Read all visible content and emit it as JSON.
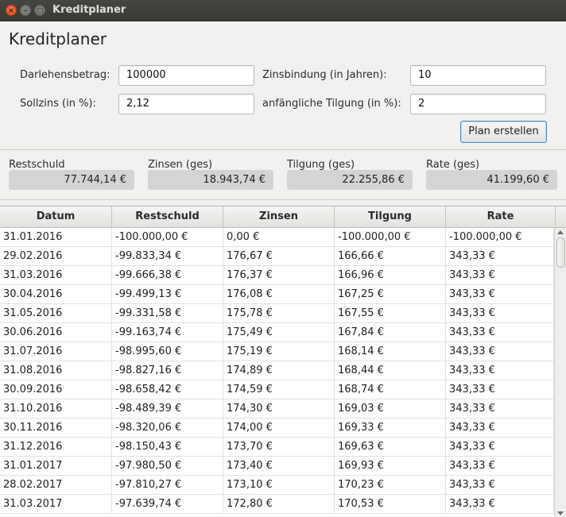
{
  "window": {
    "title": "Kreditplaner",
    "close_glyph": "×",
    "min_glyph": "–",
    "max_glyph": "□"
  },
  "app_title": "Kreditplaner",
  "form": {
    "darlehensbetrag_label": "Darlehensbetrag:",
    "darlehensbetrag_value": "100000",
    "zinsbindung_label": "Zinsbindung (in Jahren):",
    "zinsbindung_value": "10",
    "sollzins_label": "Sollzins (in %):",
    "sollzins_value": "2,12",
    "tilgung_label": "anfängliche Tilgung (in %):",
    "tilgung_value": "2",
    "plan_button": "Plan erstellen"
  },
  "summary": [
    {
      "label": "Restschuld",
      "value": "77.744,14 €"
    },
    {
      "label": "Zinsen (ges)",
      "value": "18.943,74 €"
    },
    {
      "label": "Tilgung (ges)",
      "value": "22.255,86 €"
    },
    {
      "label": "Rate (ges)",
      "value": "41.199,60 €"
    }
  ],
  "table": {
    "headers": [
      "Datum",
      "Restschuld",
      "Zinsen",
      "Tilgung",
      "Rate"
    ],
    "rows": [
      [
        "31.01.2016",
        "-100.000,00 €",
        "0,00 €",
        "-100.000,00 €",
        "-100.000,00 €"
      ],
      [
        "29.02.2016",
        "-99.833,34 €",
        "176,67 €",
        "166,66 €",
        "343,33 €"
      ],
      [
        "31.03.2016",
        "-99.666,38 €",
        "176,37 €",
        "166,96 €",
        "343,33 €"
      ],
      [
        "30.04.2016",
        "-99.499,13 €",
        "176,08 €",
        "167,25 €",
        "343,33 €"
      ],
      [
        "31.05.2016",
        "-99.331,58 €",
        "175,78 €",
        "167,55 €",
        "343,33 €"
      ],
      [
        "30.06.2016",
        "-99.163,74 €",
        "175,49 €",
        "167,84 €",
        "343,33 €"
      ],
      [
        "31.07.2016",
        "-98.995,60 €",
        "175,19 €",
        "168,14 €",
        "343,33 €"
      ],
      [
        "31.08.2016",
        "-98.827,16 €",
        "174,89 €",
        "168,44 €",
        "343,33 €"
      ],
      [
        "30.09.2016",
        "-98.658,42 €",
        "174,59 €",
        "168,74 €",
        "343,33 €"
      ],
      [
        "31.10.2016",
        "-98.489,39 €",
        "174,30 €",
        "169,03 €",
        "343,33 €"
      ],
      [
        "30.11.2016",
        "-98.320,06 €",
        "174,00 €",
        "169,33 €",
        "343,33 €"
      ],
      [
        "31.12.2016",
        "-98.150,43 €",
        "173,70 €",
        "169,63 €",
        "343,33 €"
      ],
      [
        "31.01.2017",
        "-97.980,50 €",
        "173,40 €",
        "169,93 €",
        "343,33 €"
      ],
      [
        "28.02.2017",
        "-97.810,27 €",
        "173,10 €",
        "170,23 €",
        "343,33 €"
      ],
      [
        "31.03.2017",
        "-97.639,74 €",
        "172,80 €",
        "170,53 €",
        "343,33 €"
      ]
    ]
  }
}
